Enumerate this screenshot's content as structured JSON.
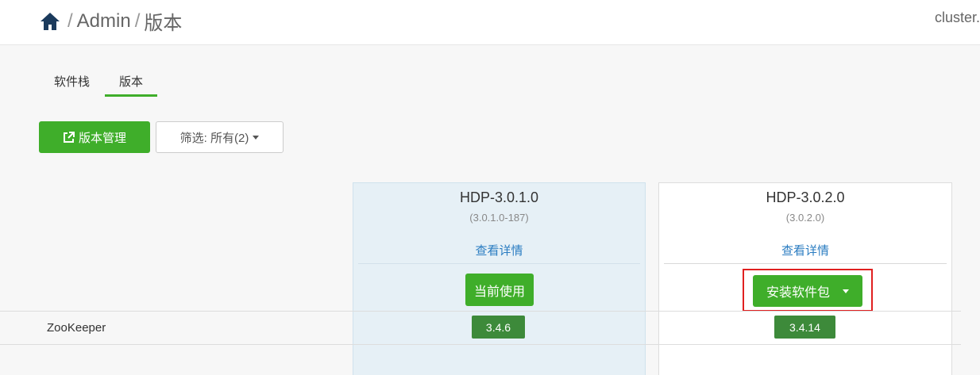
{
  "breadcrumb": {
    "sep1": "/",
    "admin": "Admin",
    "sep2": "/",
    "current": "版本"
  },
  "cluster_label": "cluster.",
  "tabs": [
    {
      "label": "软件栈"
    },
    {
      "label": "版本"
    }
  ],
  "actions": {
    "manage_label": "版本管理",
    "filter_label": "筛选: 所有(2)"
  },
  "versions": [
    {
      "name": "HDP-3.0.1.0",
      "build": "(3.0.1.0-187)",
      "details": "查看详情",
      "action": "当前使用"
    },
    {
      "name": "HDP-3.0.2.0",
      "build": "(3.0.2.0)",
      "details": "查看详情",
      "action": "安装软件包"
    }
  ],
  "components": [
    {
      "name": "ZooKeeper",
      "versions": [
        "3.4.6",
        "3.4.14"
      ]
    }
  ],
  "colors": {
    "accent": "#3fae2a",
    "badge": "#3d8a3a",
    "highlight": "#e02020",
    "link": "#2a7cc1"
  },
  "icons": {
    "home": "home-icon",
    "external": "external-link-icon",
    "caret": "caret-down-icon"
  }
}
